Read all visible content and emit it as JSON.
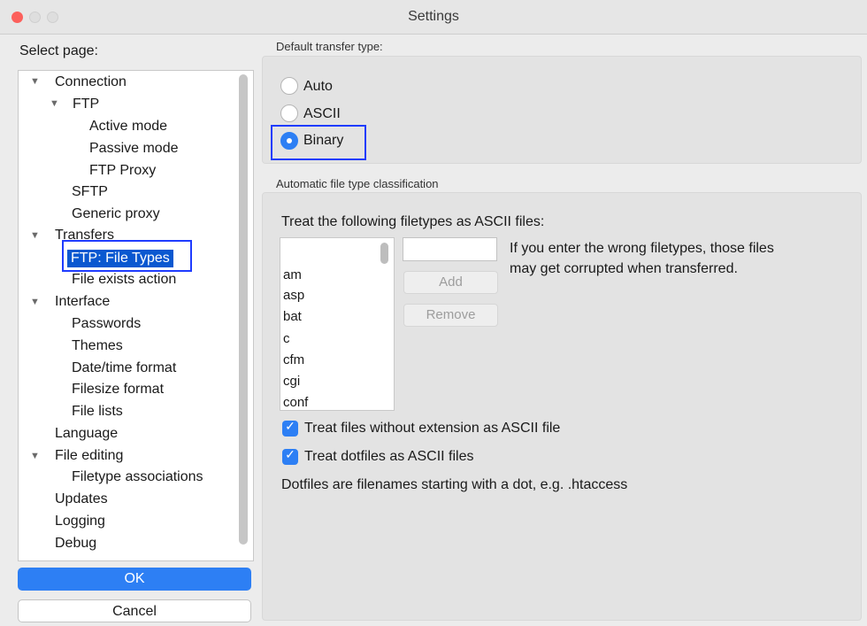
{
  "window": {
    "title": "Settings"
  },
  "left": {
    "select_label": "Select page:",
    "tree": [
      {
        "label": "Connection",
        "expanded": true
      },
      {
        "label": "FTP",
        "expanded": true
      },
      {
        "label": "Active mode"
      },
      {
        "label": "Passive mode"
      },
      {
        "label": "FTP Proxy"
      },
      {
        "label": "SFTP"
      },
      {
        "label": "Generic proxy"
      },
      {
        "label": "Transfers",
        "expanded": true
      },
      {
        "label": "FTP: File Types",
        "selected": true
      },
      {
        "label": "File exists action"
      },
      {
        "label": "Interface",
        "expanded": true
      },
      {
        "label": "Passwords"
      },
      {
        "label": "Themes"
      },
      {
        "label": "Date/time format"
      },
      {
        "label": "Filesize format"
      },
      {
        "label": "File lists"
      },
      {
        "label": "Language"
      },
      {
        "label": "File editing",
        "expanded": true
      },
      {
        "label": "Filetype associations"
      },
      {
        "label": "Updates"
      },
      {
        "label": "Logging"
      },
      {
        "label": "Debug"
      }
    ],
    "ok_label": "OK",
    "cancel_label": "Cancel"
  },
  "right": {
    "transfer_type_title": "Default transfer type:",
    "radios": [
      {
        "label": "Auto",
        "checked": false
      },
      {
        "label": "ASCII",
        "checked": false
      },
      {
        "label": "Binary",
        "checked": true
      }
    ],
    "classification_title": "Automatic file type classification",
    "treat_label": "Treat the following filetypes as ASCII files:",
    "filetypes": [
      "am",
      "asp",
      "bat",
      "c",
      "cfm",
      "cgi",
      "conf"
    ],
    "new_ext_value": "",
    "add_label": "Add",
    "remove_label": "Remove",
    "warning": "If you enter the wrong filetypes, those files may get corrupted when transferred.",
    "warning_line1": "If you enter the wrong filetypes, those files",
    "warning_line2": "may get corrupted when transferred.",
    "check_no_ext": {
      "label": "Treat files without extension as ASCII file",
      "checked": true
    },
    "check_dotfiles": {
      "label": "Treat dotfiles as ASCII files",
      "checked": true
    },
    "dotfiles_note": "Dotfiles are filenames starting with a dot, e.g. .htaccess"
  },
  "colors": {
    "accent": "#2d7ff4",
    "highlight_outline": "#1f3cff",
    "selection": "#0a58d0"
  },
  "icons": {
    "expand": "disclosure-triangle-icon",
    "check": "checkmark-icon"
  }
}
